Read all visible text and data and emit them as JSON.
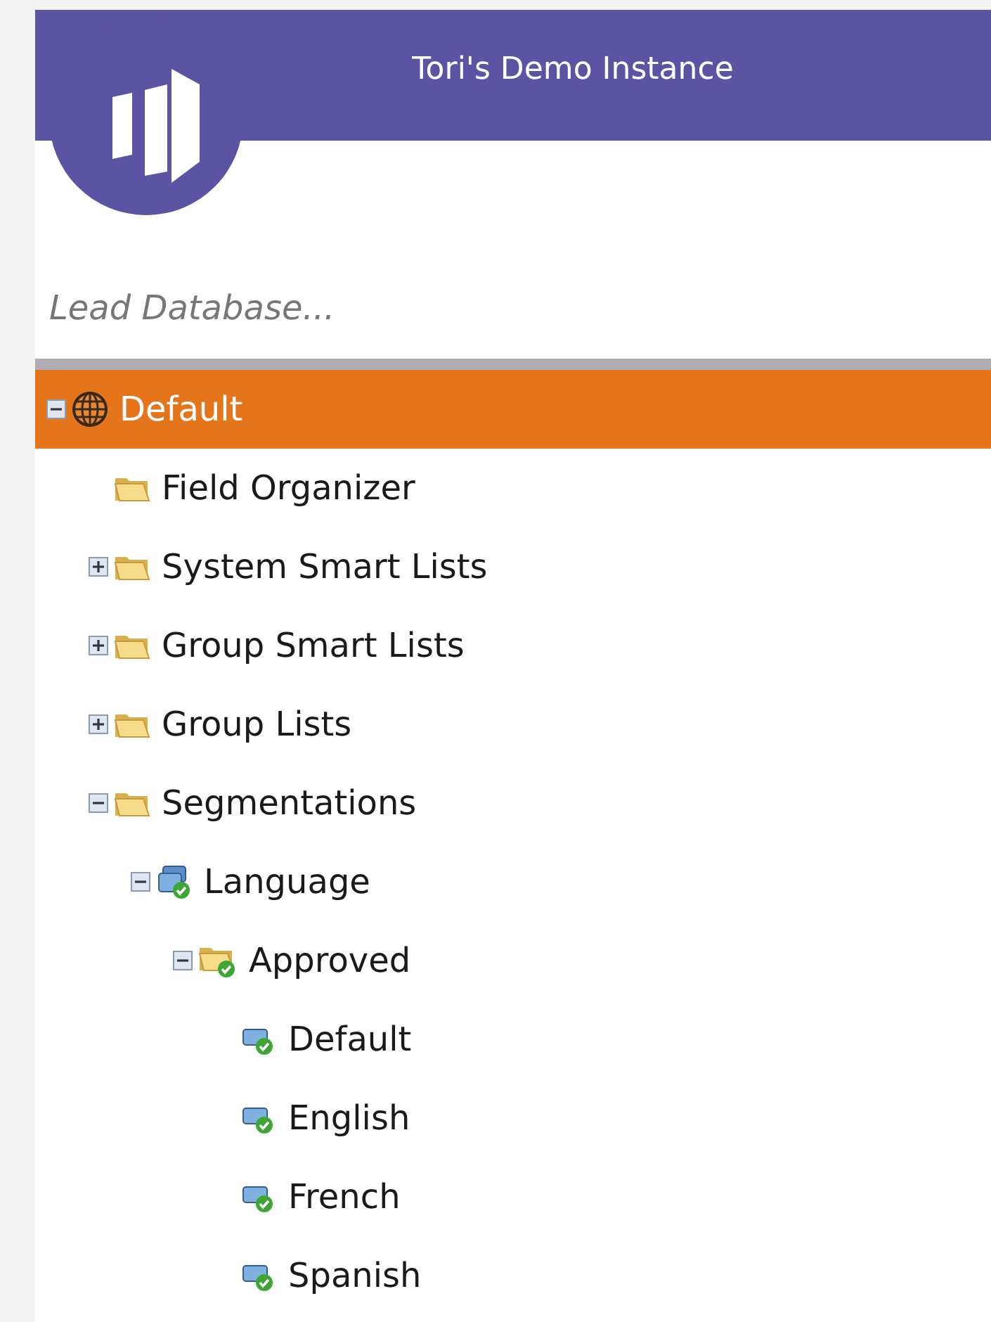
{
  "header": {
    "title": "Tori's Demo Instance"
  },
  "search": {
    "placeholder": "Lead Database..."
  },
  "tree": [
    {
      "label": "Default",
      "kind": "globe",
      "expanded": true,
      "selected": true,
      "children": [
        {
          "label": "Field Organizer",
          "kind": "folder",
          "selected": false
        },
        {
          "label": "System Smart Lists",
          "kind": "folder",
          "expanded": false,
          "selected": false
        },
        {
          "label": "Group Smart Lists",
          "kind": "folder",
          "expanded": false,
          "selected": false
        },
        {
          "label": "Group Lists",
          "kind": "folder",
          "expanded": false,
          "selected": false
        },
        {
          "label": "Segmentations",
          "kind": "folder",
          "expanded": true,
          "selected": false,
          "children": [
            {
              "label": "Language",
              "kind": "segmentation",
              "expanded": true,
              "selected": false,
              "children": [
                {
                  "label": "Approved",
                  "kind": "approved-folder",
                  "expanded": true,
                  "selected": false,
                  "children": [
                    {
                      "label": "Default",
                      "kind": "segment",
                      "selected": false
                    },
                    {
                      "label": "English",
                      "kind": "segment",
                      "selected": false
                    },
                    {
                      "label": "French",
                      "kind": "segment",
                      "selected": false
                    },
                    {
                      "label": "Spanish",
                      "kind": "segment",
                      "selected": false
                    }
                  ]
                }
              ]
            }
          ]
        }
      ]
    }
  ]
}
